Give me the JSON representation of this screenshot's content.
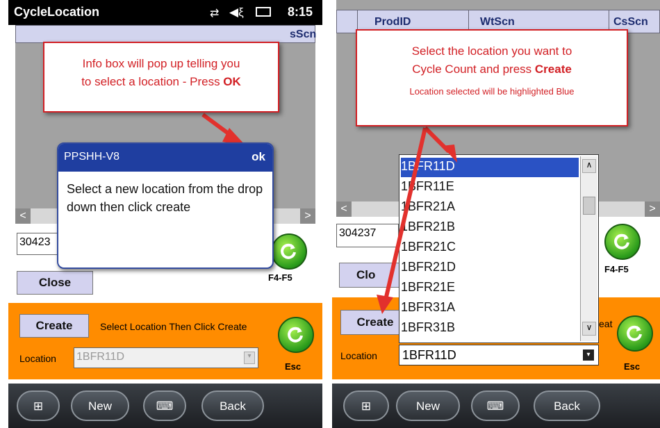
{
  "left": {
    "status": {
      "title": "CycleLocation",
      "time": "8:15"
    },
    "grid_headers": [
      "sScn"
    ],
    "location_value": "30423",
    "f4f5_label": "F4-F5",
    "close_label": "Close",
    "create_label": "Create",
    "instruction_text": "Select Location Then Click Create",
    "location_label": "Location",
    "location_select_value": "1BFR11D",
    "esc_label": "Esc",
    "callout": {
      "line1": "Info box will pop up telling you",
      "line2_prefix": "to select a location - Press ",
      "line2_bold": "OK"
    },
    "dialog": {
      "title": "PPSHH-V8",
      "ok": "ok",
      "message": "Select a new location from the drop down then click create"
    },
    "taskbar": {
      "new_label": "New",
      "back_label": "Back"
    }
  },
  "right": {
    "grid_headers": [
      "ProdID",
      "WtScn",
      "CsScn"
    ],
    "location_value": "304237",
    "f4f5_label": "F4-F5",
    "close_label": "Clo",
    "create_label": "Create",
    "instruction_fragment": "eat",
    "location_label": "Location",
    "esc_label": "Esc",
    "callout": {
      "line1": "Select the location you want to",
      "line2_prefix": "Cycle Count and press ",
      "line2_bold": "Create",
      "note": "Location selected will be highlighted Blue"
    },
    "dropdown_items": [
      "1BFR11D",
      "1BFR11E",
      "1BFR21A",
      "1BFR21B",
      "1BFR21C",
      "1BFR21D",
      "1BFR21E",
      "1BFR31A",
      "1BFR31B"
    ],
    "dropdown_value": "1BFR11D",
    "taskbar": {
      "new_label": "New",
      "back_label": "Back"
    }
  },
  "colors": {
    "orange": "#ff8c00",
    "callout_red": "#d21f24",
    "dialog_blue": "#1f3ea0",
    "selection_blue": "#2a52c4"
  }
}
